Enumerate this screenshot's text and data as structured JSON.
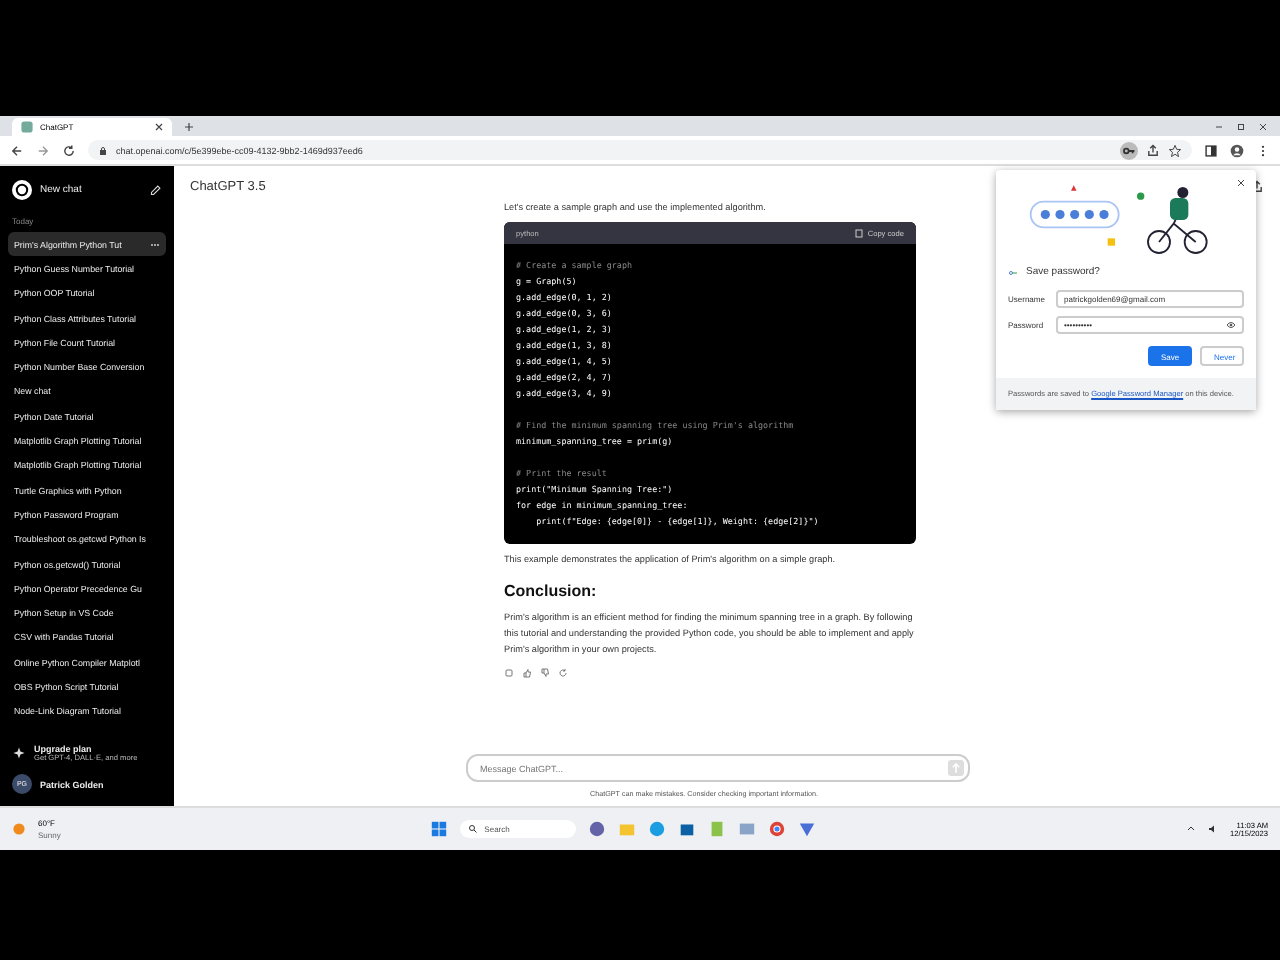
{
  "browser": {
    "tab_title": "ChatGPT",
    "url": "chat.openai.com/c/5e399ebe-cc09-4132-9bb2-1469d937eed6"
  },
  "sidebar": {
    "new_chat": "New chat",
    "section": "Today",
    "items": [
      {
        "label": "Prim's Algorithm Python Tut",
        "selected": true
      },
      {
        "label": "Python Guess Number Tutorial",
        "selected": false
      },
      {
        "label": "Python OOP Tutorial",
        "selected": false
      },
      {
        "label": "Python Class Attributes Tutorial",
        "selected": false
      },
      {
        "label": "Python File Count Tutorial",
        "selected": false
      },
      {
        "label": "Python Number Base Conversion",
        "selected": false
      },
      {
        "label": "New chat",
        "selected": false
      },
      {
        "label": "Python Date Tutorial",
        "selected": false
      },
      {
        "label": "Matplotlib Graph Plotting Tutorial",
        "selected": false
      },
      {
        "label": "Matplotlib Graph Plotting Tutorial",
        "selected": false
      },
      {
        "label": "Turtle Graphics with Python",
        "selected": false
      },
      {
        "label": "Python Password Program",
        "selected": false
      },
      {
        "label": "Troubleshoot os.getcwd Python Is",
        "selected": false
      },
      {
        "label": "Python os.getcwd() Tutorial",
        "selected": false
      },
      {
        "label": "Python Operator Precedence Gu",
        "selected": false
      },
      {
        "label": "Python Setup in VS Code",
        "selected": false
      },
      {
        "label": "CSV with Pandas Tutorial",
        "selected": false
      },
      {
        "label": "Online Python Compiler Matplotl",
        "selected": false
      },
      {
        "label": "OBS Python Script Tutorial",
        "selected": false
      },
      {
        "label": "Node-Link Diagram Tutorial",
        "selected": false
      }
    ],
    "upgrade": {
      "title": "Upgrade plan",
      "subtitle": "Get GPT-4, DALL·E, and more"
    },
    "user": {
      "initials": "PG",
      "name": "Patrick Golden"
    }
  },
  "header": {
    "model": "ChatGPT 3.5"
  },
  "chat": {
    "intro": "Let's create a sample graph and use the implemented algorithm.",
    "code": {
      "language": "python",
      "copy": "Copy code",
      "lines": [
        {
          "text": "# Create a sample graph",
          "kind": "comment"
        },
        {
          "text": "g = Graph(5)",
          "kind": "code"
        },
        {
          "text": "g.add_edge(0, 1, 2)",
          "kind": "code"
        },
        {
          "text": "g.add_edge(0, 3, 6)",
          "kind": "code"
        },
        {
          "text": "g.add_edge(1, 2, 3)",
          "kind": "code"
        },
        {
          "text": "g.add_edge(1, 3, 8)",
          "kind": "code"
        },
        {
          "text": "g.add_edge(1, 4, 5)",
          "kind": "code"
        },
        {
          "text": "g.add_edge(2, 4, 7)",
          "kind": "code"
        },
        {
          "text": "g.add_edge(3, 4, 9)",
          "kind": "code"
        },
        {
          "kind": "blank"
        },
        {
          "text": "# Find the minimum spanning tree using Prim's algorithm",
          "kind": "comment"
        },
        {
          "text": "minimum_spanning_tree = prim(g)",
          "kind": "code"
        },
        {
          "kind": "blank"
        },
        {
          "text": "# Print the result",
          "kind": "comment"
        },
        {
          "text": "print(\"Minimum Spanning Tree:\")",
          "kind": "code"
        },
        {
          "text": "for edge in minimum_spanning_tree:",
          "kind": "code"
        },
        {
          "text": "    print(f\"Edge: {edge[0]} - {edge[1]}, Weight: {edge[2]}\")",
          "kind": "code"
        }
      ]
    },
    "after": "This example demonstrates the application of Prim's algorithm on a simple graph.",
    "heading": "Conclusion:",
    "conclusion": "Prim's algorithm is an efficient method for finding the minimum spanning tree in a graph. By following this tutorial and understanding the provided Python code, you should be able to implement and apply Prim's algorithm in your own projects."
  },
  "composer": {
    "placeholder": "Message ChatGPT...",
    "disclaimer": "ChatGPT can make mistakes. Consider checking important information."
  },
  "password_popup": {
    "title": "Save password?",
    "username_label": "Username",
    "username": "patrickgolden69@gmail.com",
    "password_label": "Password",
    "password": "••••••••••",
    "save": "Save",
    "never": "Never",
    "footer": "Passwords are saved to",
    "footer_link": "Google Password Manager",
    "footer_end": "on this device."
  },
  "taskbar": {
    "temperature": "60°F",
    "weather": "Sunny",
    "search": "Search",
    "time": "11:03 AM",
    "date": "12/15/2023"
  }
}
